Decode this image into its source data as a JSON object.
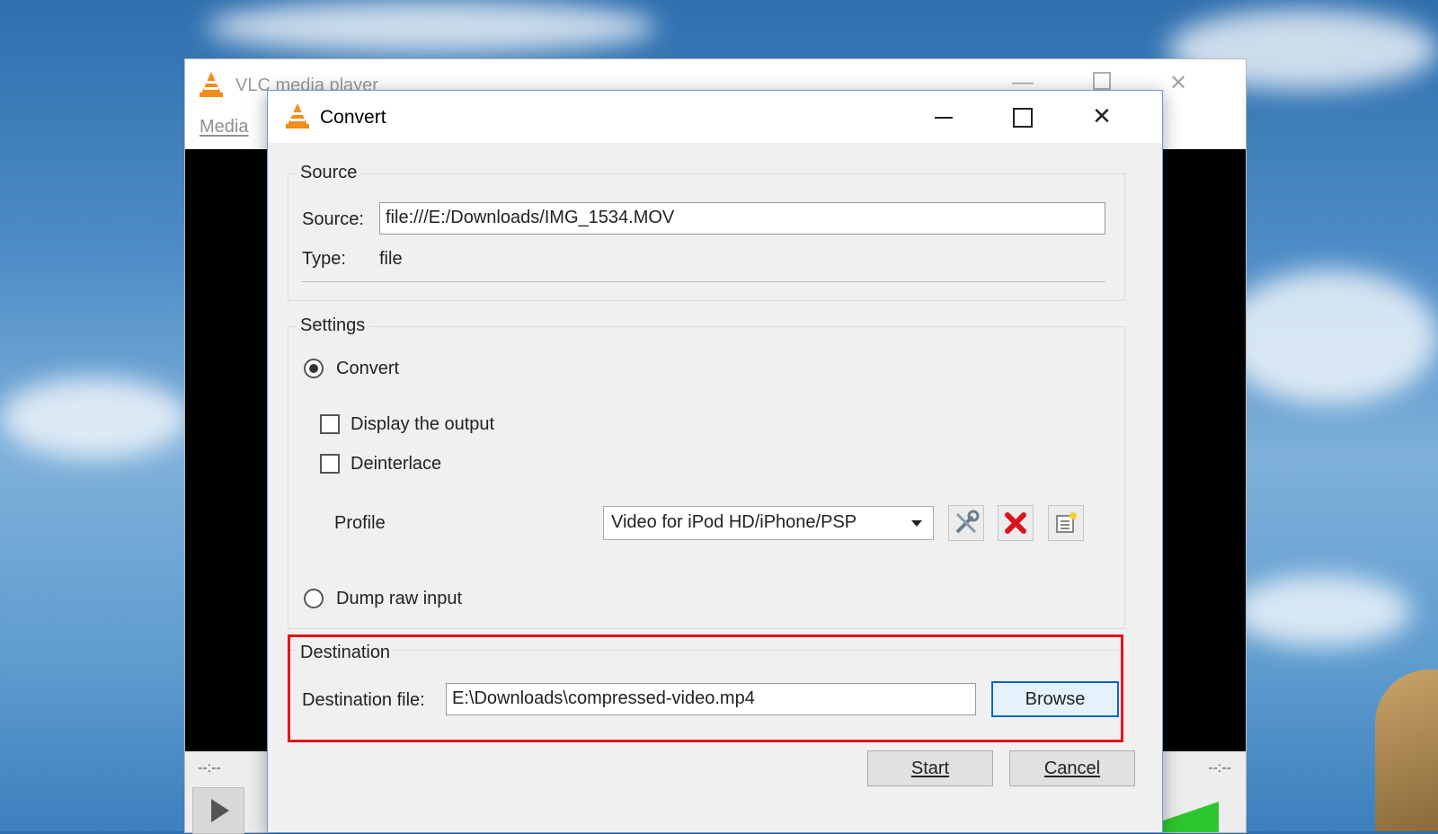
{
  "background_window": {
    "title": "VLC media player",
    "menu_media": "Media",
    "time_elapsed": "--:--",
    "time_total": "--:--"
  },
  "dialog": {
    "title": "Convert",
    "source_group": {
      "title": "Source",
      "source_label": "Source:",
      "source_value": "file:///E:/Downloads/IMG_1534.MOV",
      "type_label": "Type:",
      "type_value": "file"
    },
    "settings_group": {
      "title": "Settings",
      "convert_label": "Convert",
      "convert_selected": true,
      "display_output_label": "Display the output",
      "display_output_checked": false,
      "deinterlace_label": "Deinterlace",
      "deinterlace_checked": false,
      "profile_label": "Profile",
      "profile_value": "Video for iPod HD/iPhone/PSP",
      "dump_raw_label": "Dump raw input",
      "dump_raw_selected": false
    },
    "destination_group": {
      "title": "Destination",
      "dest_label": "Destination file:",
      "dest_value": "E:\\Downloads\\compressed-video.mp4",
      "browse_label": "Browse"
    },
    "start_label": "Start",
    "cancel_label": "Cancel"
  },
  "colors": {
    "highlight": "#e0141e",
    "focus_border": "#0a64c8",
    "vlc_orange": "#f28c1a"
  }
}
